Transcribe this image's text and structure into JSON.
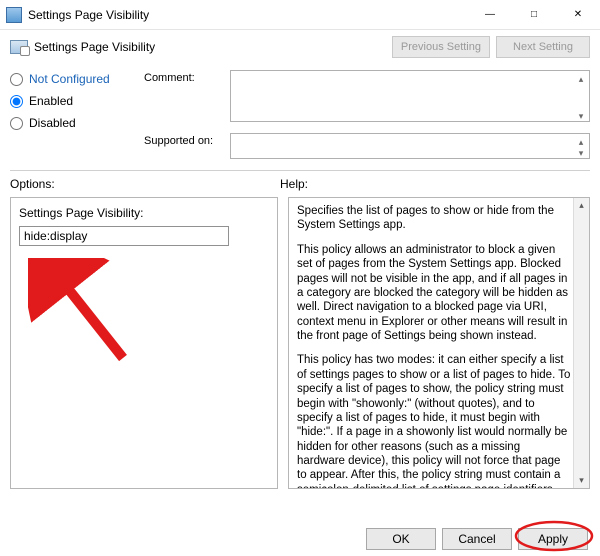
{
  "window": {
    "title": "Settings Page Visibility"
  },
  "header": {
    "title": "Settings Page Visibility",
    "prev_label": "Previous Setting",
    "next_label": "Next Setting"
  },
  "state": {
    "not_configured_label": "Not Configured",
    "enabled_label": "Enabled",
    "disabled_label": "Disabled",
    "selected": "enabled"
  },
  "fields": {
    "comment_label": "Comment:",
    "comment_value": "",
    "supported_label": "Supported on:",
    "supported_value": ""
  },
  "sections": {
    "options_label": "Options:",
    "help_label": "Help:"
  },
  "options": {
    "field_label": "Settings Page Visibility:",
    "field_value": "hide:display"
  },
  "help": {
    "p1": "Specifies the list of pages to show or hide from the System Settings app.",
    "p2": "This policy allows an administrator to block a given set of pages from the System Settings app. Blocked pages will not be visible in the app, and if all pages in a category are blocked the category will be hidden as well. Direct navigation to a blocked page via URI, context menu in Explorer or other means will result in the front page of Settings being shown instead.",
    "p3": "This policy has two modes: it can either specify a list of settings pages to show or a list of pages to hide. To specify a list of pages to show, the policy string must begin with \"showonly:\" (without quotes), and to specify a list of pages to hide, it must begin with \"hide:\". If a page in a showonly list would normally be hidden for other reasons (such as a missing hardware device), this policy will not force that page to appear. After this, the policy string must contain a semicolon-delimited list of settings page identifiers. The identifier for any given settings page is the published URI for that page, minus the \"ms-settings:\" protocol part."
  },
  "buttons": {
    "ok": "OK",
    "cancel": "Cancel",
    "apply": "Apply"
  },
  "annotation": {
    "color": "#e11b1b"
  }
}
